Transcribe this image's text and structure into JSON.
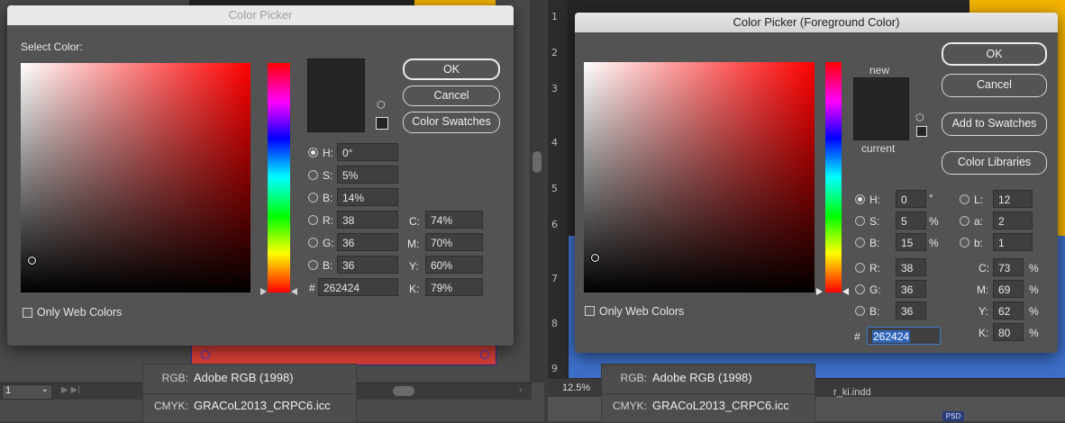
{
  "left_dialog": {
    "title": "Color Picker",
    "select_color_label": "Select Color:",
    "buttons": {
      "ok": "OK",
      "cancel": "Cancel",
      "swatches": "Color Swatches"
    },
    "fields": {
      "h": {
        "label": "H:",
        "value": "0°"
      },
      "s": {
        "label": "S:",
        "value": "5%"
      },
      "b": {
        "label": "B:",
        "value": "14%"
      },
      "r": {
        "label": "R:",
        "value": "38"
      },
      "g": {
        "label": "G:",
        "value": "36"
      },
      "bl": {
        "label": "B:",
        "value": "36"
      },
      "c": {
        "label": "C:",
        "value": "74%"
      },
      "m": {
        "label": "M:",
        "value": "70%"
      },
      "y": {
        "label": "Y:",
        "value": "60%"
      },
      "k": {
        "label": "K:",
        "value": "79%"
      },
      "hex": {
        "label": "#",
        "value": "262424"
      }
    },
    "only_web_colors": "Only Web Colors",
    "swatch_color": "#262424"
  },
  "right_dialog": {
    "title": "Color Picker (Foreground Color)",
    "new_label": "new",
    "current_label": "current",
    "buttons": {
      "ok": "OK",
      "cancel": "Cancel",
      "add_swatches": "Add to Swatches",
      "libraries": "Color Libraries"
    },
    "fields": {
      "h": {
        "label": "H:",
        "value": "0",
        "unit": "°"
      },
      "s": {
        "label": "S:",
        "value": "5",
        "unit": "%"
      },
      "b": {
        "label": "B:",
        "value": "15",
        "unit": "%"
      },
      "r": {
        "label": "R:",
        "value": "38"
      },
      "g": {
        "label": "G:",
        "value": "36"
      },
      "bl": {
        "label": "B:",
        "value": "36"
      },
      "l": {
        "label": "L:",
        "value": "12"
      },
      "a": {
        "label": "a:",
        "value": "2"
      },
      "lb": {
        "label": "b:",
        "value": "1"
      },
      "c": {
        "label": "C:",
        "value": "73",
        "unit": "%"
      },
      "m": {
        "label": "M:",
        "value": "69",
        "unit": "%"
      },
      "y": {
        "label": "Y:",
        "value": "62",
        "unit": "%"
      },
      "k": {
        "label": "K:",
        "value": "80",
        "unit": "%"
      },
      "hex": {
        "label": "#",
        "value": "262424"
      }
    },
    "only_web_colors": "Only Web Colors",
    "swatch_color": "#262424"
  },
  "left_app": {
    "page_number": "1",
    "profile": {
      "rgb_label": "RGB:",
      "rgb_value": "Adobe RGB (1998)",
      "cmyk_label": "CMYK:",
      "cmyk_value": "GRACoL2013_CRPC6.icc"
    }
  },
  "right_app": {
    "ruler_numbers": [
      "1",
      "2",
      "3",
      "4",
      "5",
      "6",
      "7",
      "8",
      "9"
    ],
    "zoom": "12.5%",
    "profile": {
      "rgb_label": "RGB:",
      "rgb_value": "Adobe RGB (1998)",
      "cmyk_label": "CMYK:",
      "cmyk_value": "GRACoL2013_CRPC6.icc"
    },
    "partial_filename": "r_ki.indd",
    "psd_badge": "PSD"
  },
  "colors": {
    "accent_red": "#d33c35",
    "canvas_yellow": "#f5b400",
    "canvas_blue": "#3d6fc9",
    "dialog_bg": "#535353"
  }
}
